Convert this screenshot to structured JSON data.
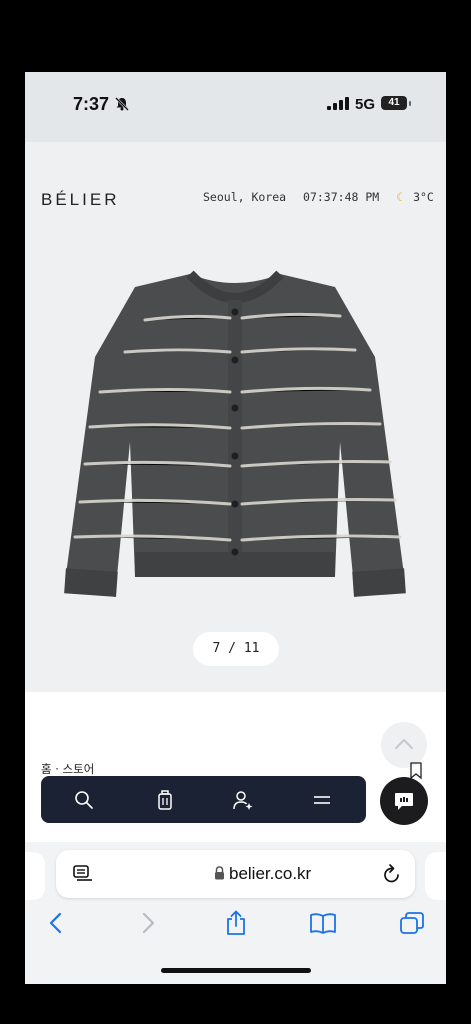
{
  "status": {
    "time": "7:37",
    "network": "5G",
    "battery": "41"
  },
  "site": {
    "brand": "BÉLIER",
    "location": "Seoul, Korea",
    "clock": "07:37:48 PM",
    "weather_icon": "moon-icon",
    "temperature": "3°C"
  },
  "gallery": {
    "current": "7",
    "separator": "/",
    "total": "11",
    "label": "7 / 11"
  },
  "breadcrumb": "홈 · 스토어",
  "toolbar": [
    "search-icon",
    "trash-icon",
    "user-icon",
    "menu-icon"
  ],
  "safari": {
    "url": "belier.co.kr"
  },
  "colors": {
    "toolbar_bg": "#1b2233",
    "link_blue": "#1a73e8",
    "page_bg": "#eef0f2"
  }
}
